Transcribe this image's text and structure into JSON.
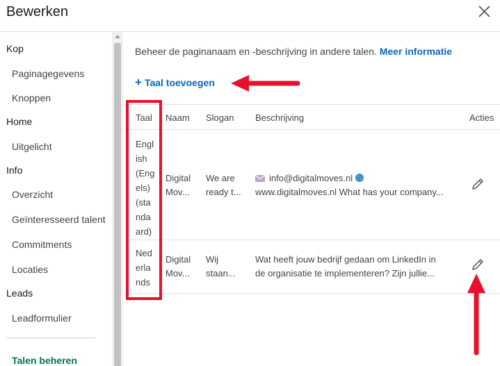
{
  "header": {
    "title": "Bewerken",
    "close_icon": "close-icon"
  },
  "sidebar": {
    "items": [
      {
        "label": "Kop",
        "type": "section"
      },
      {
        "label": "Paginagegevens",
        "type": "sub"
      },
      {
        "label": "Knoppen",
        "type": "sub"
      },
      {
        "label": "Home",
        "type": "section"
      },
      {
        "label": "Uitgelicht",
        "type": "sub"
      },
      {
        "label": "Info",
        "type": "section"
      },
      {
        "label": "Overzicht",
        "type": "sub"
      },
      {
        "label": "Geïnteresseerd talent",
        "type": "sub"
      },
      {
        "label": "Commitments",
        "type": "sub"
      },
      {
        "label": "Locaties",
        "type": "sub"
      },
      {
        "label": "Leads",
        "type": "section"
      },
      {
        "label": "Leadformulier",
        "type": "sub"
      },
      {
        "label": "Talen beheren",
        "type": "active"
      }
    ]
  },
  "main": {
    "intro_text": "Beheer de paginanaam en -beschrijving in andere talen.",
    "more_info_link": "Meer informatie",
    "add_language": "Taal toevoegen",
    "table": {
      "headers": {
        "taal": "Taal",
        "naam": "Naam",
        "slogan": "Slogan",
        "beschrijving": "Beschrijving",
        "acties": "Acties"
      },
      "rows": [
        {
          "taal_lines": [
            "Engl",
            "ish",
            "(Eng",
            "els)",
            "(sta",
            "nda",
            "ard)"
          ],
          "naam_lines": [
            "Digital",
            "Mov..."
          ],
          "slogan_lines": [
            "We are",
            "ready t..."
          ],
          "beschrijving_email": "info@digitalmoves.nl",
          "beschrijving_line2": "www.digitalmoves.nl What has your company..."
        },
        {
          "taal_lines": [
            "Ned",
            "erla",
            "nds"
          ],
          "naam_lines": [
            "Digital",
            "Mov..."
          ],
          "slogan_lines": [
            "Wij",
            "staan..."
          ],
          "beschrijving_line1": "Wat heeft jouw bedrijf gedaan om LinkedIn in",
          "beschrijving_line2": "de organisatie te implementeren? Zijn jullie..."
        }
      ]
    }
  },
  "colors": {
    "link": "#0a66c2",
    "active_nav": "#057642",
    "annotation_red": "#e8112d"
  }
}
